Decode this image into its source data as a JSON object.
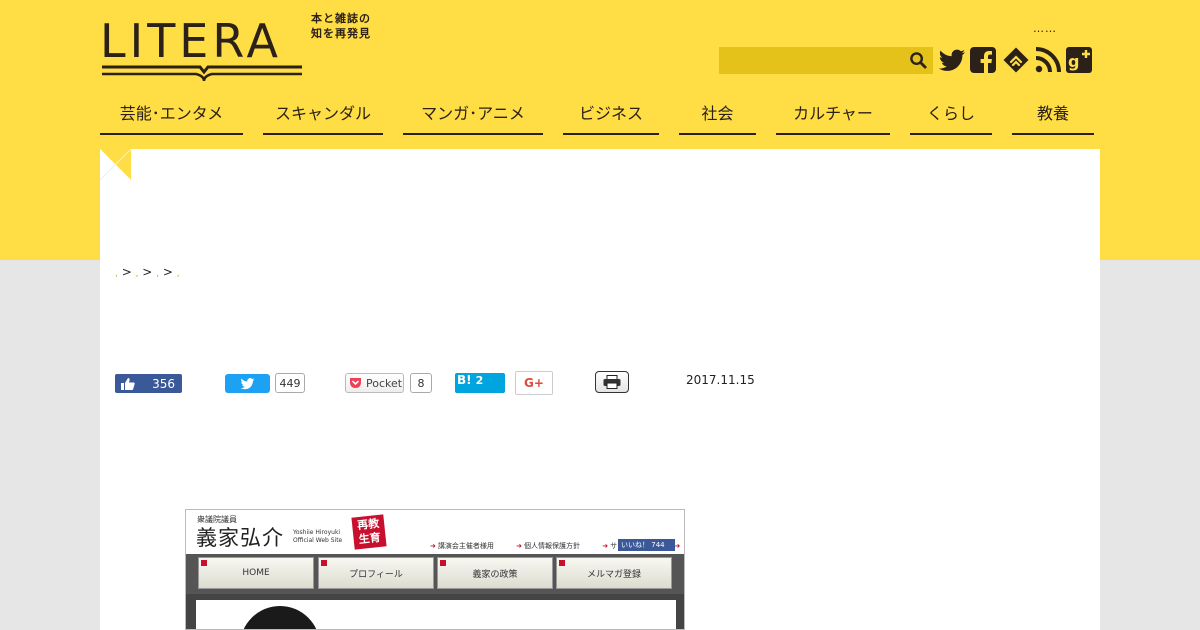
{
  "logo": {
    "word": "LITERA",
    "tagline_line1": "本と雑誌の",
    "tagline_line2": "知を再発見"
  },
  "header": {
    "dots": "……",
    "search_placeholder": ""
  },
  "social_icons": [
    "twitter-icon",
    "facebook-icon",
    "feedly-icon",
    "rss-icon",
    "google-plus-icon"
  ],
  "nav": {
    "items": [
      {
        "label": "芸能･エンタメ"
      },
      {
        "label": "スキャンダル"
      },
      {
        "label": "マンガ･アニメ"
      },
      {
        "label": "ビジネス"
      },
      {
        "label": "社会"
      },
      {
        "label": "カルチャー"
      },
      {
        "label": "くらし"
      },
      {
        "label": "教養"
      }
    ]
  },
  "breadcrumb": {
    "sep": ">"
  },
  "share": {
    "like_count": "356",
    "tweet_count": "449",
    "pocket_label": "Pocket",
    "pocket_count": "8",
    "hatena_label": "B!",
    "hatena_count": "2",
    "gplus_label": "G+"
  },
  "post": {
    "date": "2017.11.15"
  },
  "embedded_screenshot": {
    "subtitle": "衆議院議員",
    "name": "義家弘介",
    "en_line1": "Yoshiie Hiroyuki",
    "en_line2": "Official Web Site",
    "stamp_line1": "再教",
    "stamp_line2": "生育",
    "links": [
      "講演会主催者様用",
      "個人情報保護方針",
      "サイトマップ"
    ],
    "fb_label": "いいね！",
    "fb_count": "744",
    "tabs": [
      "HOME",
      "プロフィール",
      "義家の政策",
      "メルマガ登録"
    ]
  },
  "colors": {
    "brand_yellow": "#ffdd44",
    "search_bg": "#e5c21a",
    "text_dark": "#2b2118",
    "facebook": "#3b5998",
    "twitter": "#1da1f2",
    "hatena": "#00a4de"
  }
}
